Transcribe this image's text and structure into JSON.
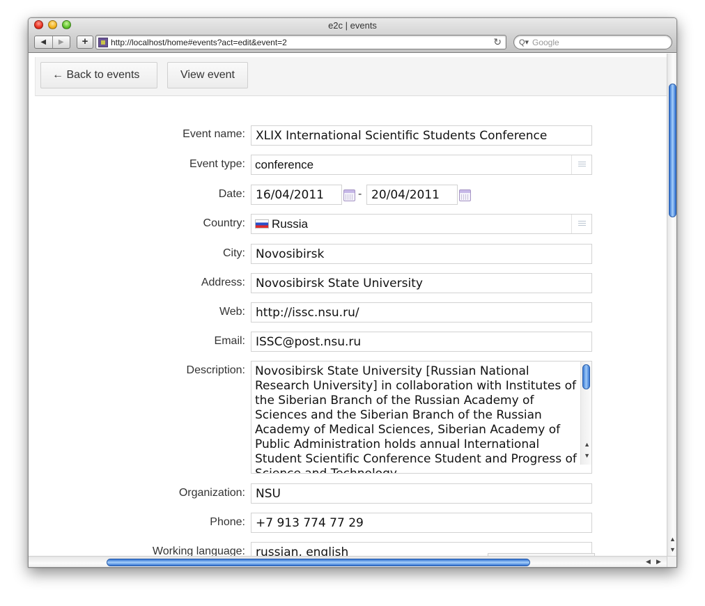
{
  "window": {
    "title": "e2c | events"
  },
  "browser": {
    "url": "http://localhost/home#events?act=edit&event=2",
    "search_placeholder": "Google",
    "back_icon": "◀",
    "forward_icon": "▶",
    "add_icon": "+",
    "reload_icon": "↻",
    "search_icon": "Q▾"
  },
  "toolbar": {
    "back_label": "← Back to events",
    "view_label": "View event"
  },
  "form": {
    "event_name": {
      "label": "Event name:",
      "value": "XLIX International Scientific Students Conference"
    },
    "event_type": {
      "label": "Event type:",
      "value": "conference"
    },
    "date": {
      "label": "Date:",
      "start": "16/04/2011",
      "separator": "-",
      "end": "20/04/2011"
    },
    "country": {
      "label": "Country:",
      "value": "Russia"
    },
    "city": {
      "label": "City:",
      "value": "Novosibirsk"
    },
    "address": {
      "label": "Address:",
      "value": "Novosibirsk State University"
    },
    "web": {
      "label": "Web:",
      "value": "http://issc.nsu.ru/"
    },
    "email": {
      "label": "Email:",
      "value": "ISSC@post.nsu.ru"
    },
    "description": {
      "label": "Description:",
      "value": "Novosibirsk State University [Russian National Research University] in collaboration with Institutes of the Siberian Branch of the Russian Academy of Sciences and the Siberian Branch of the Russian Academy of Medical Sciences, Siberian Academy of Public Administration holds annual International Student Scientific Conference Student and Progress of Science and Technology"
    },
    "organization": {
      "label": "Organization:",
      "value": "NSU"
    },
    "phone": {
      "label": "Phone:",
      "value": "+7 913 774 77 29"
    },
    "working_language": {
      "label": "Working language:",
      "value": "russian, english"
    }
  }
}
